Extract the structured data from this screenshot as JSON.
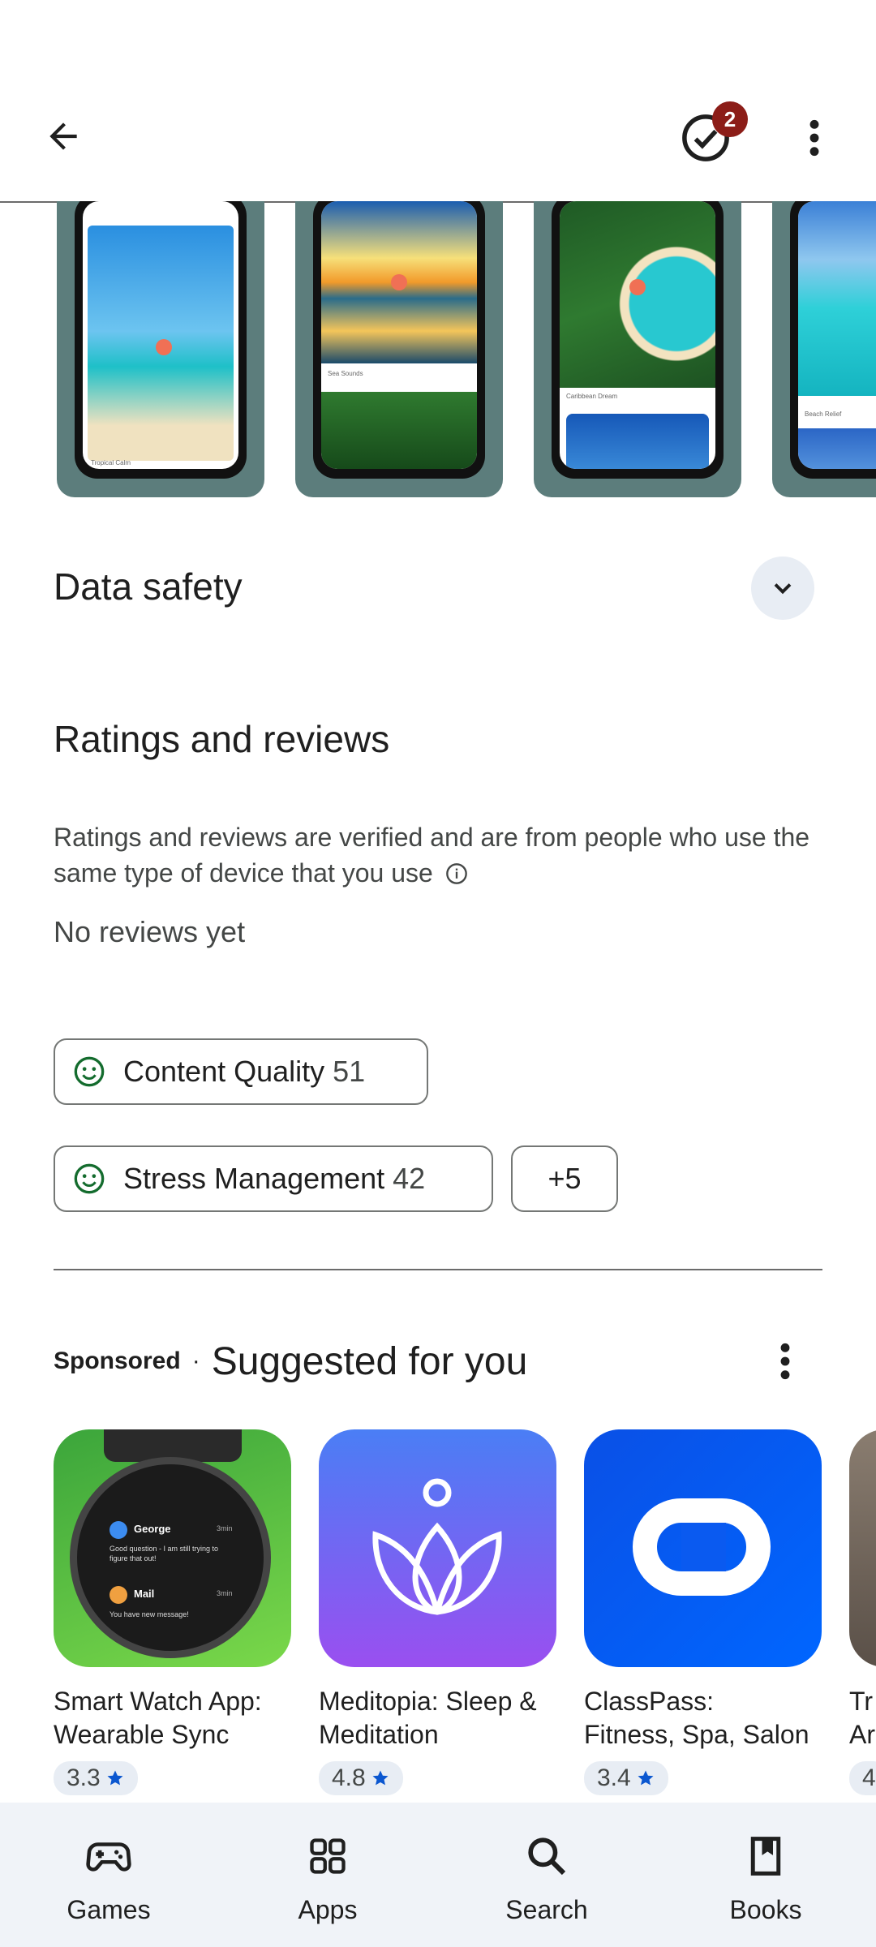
{
  "header": {
    "back_icon": "arrow-left-icon",
    "updates_icon": "check-circle-icon",
    "updates_badge": "2",
    "more_icon": "more-vert-icon"
  },
  "screenshots": [
    {
      "caption": "Tropical Calm"
    },
    {
      "caption": "Sea Sounds"
    },
    {
      "caption": "Caribbean Dream"
    },
    {
      "caption": "Beach Relief"
    }
  ],
  "data_safety": {
    "title": "Data safety",
    "expand_icon": "chevron-down-icon"
  },
  "ratings": {
    "title": "Ratings and reviews",
    "info": "Ratings and reviews are verified and are from people who use the same type of device that you use",
    "info_icon": "info-icon",
    "no_reviews": "No reviews yet"
  },
  "chips": [
    {
      "label": "Content Quality",
      "count": "51",
      "icon": "smile-icon"
    },
    {
      "label": "Stress Management",
      "count": "42",
      "icon": "smile-icon"
    },
    {
      "label": "+5"
    }
  ],
  "suggested": {
    "sponsored": "Sponsored",
    "separator": "·",
    "title": "Suggested for you",
    "more_icon": "more-vert-icon",
    "apps": [
      {
        "title_line1": "Smart Watch App:",
        "title_line2": "Wearable Sync",
        "rating": "3.3",
        "icon_texts": {
          "name1": "George",
          "time1": "3min",
          "msg1": "Good question - I am still trying to figure that out!",
          "name2": "Mail",
          "time2": "3min",
          "msg2": "You have new message!"
        }
      },
      {
        "title_line1": "Meditopia: Sleep &",
        "title_line2": "Meditation",
        "rating": "4.8"
      },
      {
        "title_line1": "ClassPass:",
        "title_line2": "Fitness, Spa, Salon",
        "rating": "3.4"
      },
      {
        "title_line1": "Tr",
        "title_line2": "Ar",
        "rating": "4"
      }
    ]
  },
  "nav": [
    {
      "label": "Games",
      "icon": "gamepad-icon"
    },
    {
      "label": "Apps",
      "icon": "apps-grid-icon"
    },
    {
      "label": "Search",
      "icon": "search-icon"
    },
    {
      "label": "Books",
      "icon": "bookmark-icon"
    }
  ],
  "colors": {
    "accent": "#0b57d0",
    "badge": "#8c1d18",
    "smile": "#146c2e",
    "nav_bg": "#f0f3f8"
  }
}
